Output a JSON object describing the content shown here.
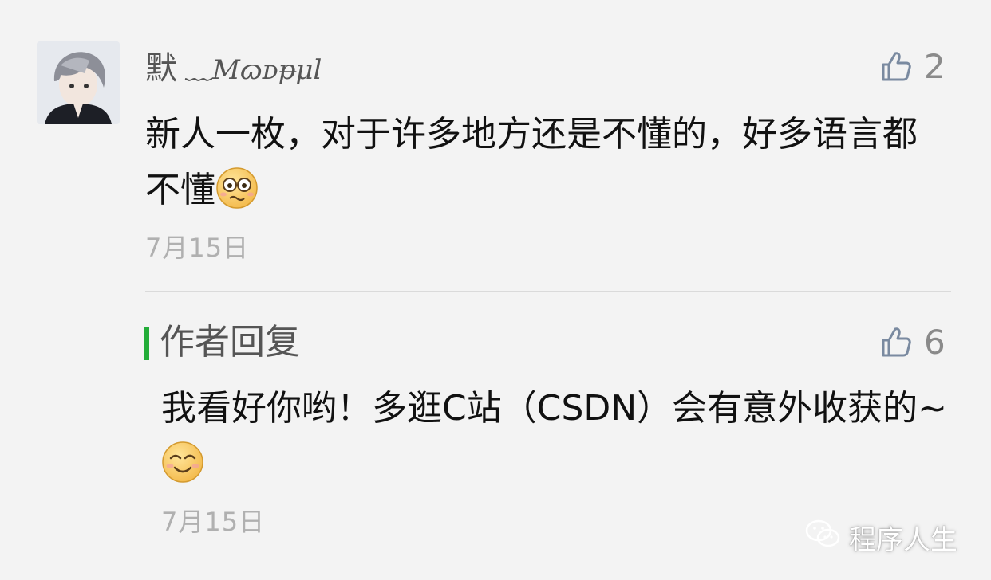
{
  "comment": {
    "author_name_cn": "默",
    "author_name_fancy": "﹏Mɷᴅᵽμl",
    "likes": "2",
    "text": "新人一枚，对于许多地方还是不懂的，好多语言都不懂",
    "emoji_icon": "nervous-face-icon",
    "date": "7月15日"
  },
  "reply": {
    "title": "作者回复",
    "likes": "6",
    "text": "我看好你哟！多逛C站（CSDN）会有意外收获的~",
    "emoji_icon": "smiling-face-icon",
    "date": "7月15日"
  },
  "watermark": {
    "label": "程序人生",
    "icon": "wechat-icon"
  },
  "colors": {
    "background": "#f3f3f3",
    "accent_green": "#22ac38",
    "muted_text": "#b0b0b0",
    "like_icon": "#7a8aa0"
  }
}
